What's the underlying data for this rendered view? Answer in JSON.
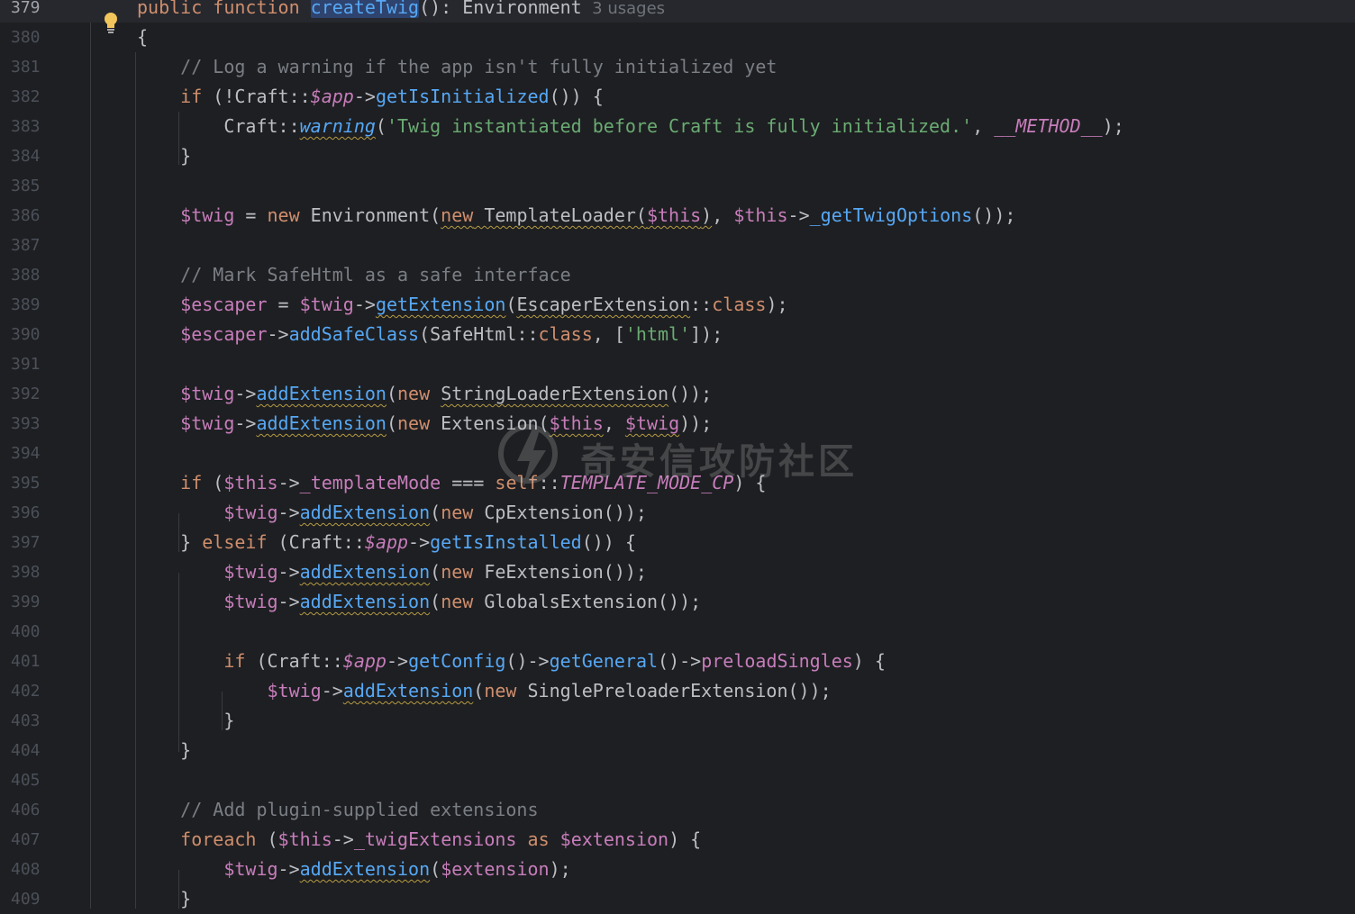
{
  "editor": {
    "current_line": 379,
    "usage_hint": "3 usages",
    "watermark": "奇安信攻防社区",
    "lines": [
      {
        "n": "379",
        "tokens": [
          [
            "kw",
            "public"
          ],
          [
            "pl",
            " "
          ],
          [
            "kw",
            "function"
          ],
          [
            "pl",
            " "
          ],
          [
            "fn hl",
            "createTwig"
          ],
          [
            "pl",
            "(): Environment"
          ]
        ]
      },
      {
        "n": "380",
        "tokens": [
          [
            "pl",
            "{"
          ]
        ]
      },
      {
        "n": "381",
        "tokens": [
          [
            "cmt",
            "    // Log a warning if the app isn't fully initialized yet"
          ]
        ]
      },
      {
        "n": "382",
        "tokens": [
          [
            "kw",
            "    if"
          ],
          [
            "pl",
            " (!Craft::"
          ],
          [
            "var it",
            "$app"
          ],
          [
            "pl",
            "->"
          ],
          [
            "fn",
            "getIsInitialized"
          ],
          [
            "pl",
            "()) {"
          ]
        ]
      },
      {
        "n": "383",
        "tokens": [
          [
            "pl",
            "        Craft::"
          ],
          [
            "fn it wv",
            "warning"
          ],
          [
            "pl",
            "("
          ],
          [
            "str",
            "'Twig instantiated before Craft is fully initialized.'"
          ],
          [
            "pl",
            ", "
          ],
          [
            "var it",
            "__METHOD__"
          ],
          [
            "pl",
            ");"
          ]
        ]
      },
      {
        "n": "384",
        "tokens": [
          [
            "pl",
            "    }"
          ]
        ]
      },
      {
        "n": "385",
        "tokens": []
      },
      {
        "n": "386",
        "tokens": [
          [
            "var",
            "    $twig"
          ],
          [
            "pl",
            " = "
          ],
          [
            "kw",
            "new"
          ],
          [
            "pl",
            " Environment("
          ],
          [
            "kw wv",
            "new"
          ],
          [
            "pl wv",
            " TemplateLoader("
          ],
          [
            "var wv",
            "$this"
          ],
          [
            "pl wv",
            ")"
          ],
          [
            "pl",
            ", "
          ],
          [
            "var",
            "$this"
          ],
          [
            "pl",
            "->"
          ],
          [
            "fn",
            "_getTwigOptions"
          ],
          [
            "pl",
            "());"
          ]
        ]
      },
      {
        "n": "387",
        "tokens": []
      },
      {
        "n": "388",
        "tokens": [
          [
            "cmt",
            "    // Mark SafeHtml as a safe interface"
          ]
        ]
      },
      {
        "n": "389",
        "tokens": [
          [
            "var",
            "    $escaper"
          ],
          [
            "pl",
            " = "
          ],
          [
            "var",
            "$twig"
          ],
          [
            "pl",
            "->"
          ],
          [
            "fn wv",
            "getExtension"
          ],
          [
            "pl",
            "("
          ],
          [
            "pl wv",
            "EscaperExtension"
          ],
          [
            "pl",
            "::"
          ],
          [
            "kw",
            "class"
          ],
          [
            "pl",
            ");"
          ]
        ]
      },
      {
        "n": "390",
        "tokens": [
          [
            "var",
            "    $escaper"
          ],
          [
            "pl",
            "->"
          ],
          [
            "fn",
            "addSafeClass"
          ],
          [
            "pl",
            "(SafeHtml::"
          ],
          [
            "kw",
            "class"
          ],
          [
            "pl",
            ", ["
          ],
          [
            "str",
            "'html'"
          ],
          [
            "pl",
            "]);"
          ]
        ]
      },
      {
        "n": "391",
        "tokens": []
      },
      {
        "n": "392",
        "tokens": [
          [
            "var",
            "    $twig"
          ],
          [
            "pl",
            "->"
          ],
          [
            "fn wv",
            "addExtension"
          ],
          [
            "pl",
            "("
          ],
          [
            "kw",
            "new"
          ],
          [
            "pl",
            " "
          ],
          [
            "pl wv",
            "StringLoaderExtension"
          ],
          [
            "pl",
            "());"
          ]
        ]
      },
      {
        "n": "393",
        "tokens": [
          [
            "var",
            "    $twig"
          ],
          [
            "pl",
            "->"
          ],
          [
            "fn wv",
            "addExtension"
          ],
          [
            "pl",
            "("
          ],
          [
            "kw",
            "new"
          ],
          [
            "pl",
            " Extension("
          ],
          [
            "var wv",
            "$this"
          ],
          [
            "pl",
            ", "
          ],
          [
            "var wv",
            "$twig"
          ],
          [
            "pl",
            "));"
          ]
        ]
      },
      {
        "n": "394",
        "tokens": []
      },
      {
        "n": "395",
        "tokens": [
          [
            "kw",
            "    if"
          ],
          [
            "pl",
            " ("
          ],
          [
            "var",
            "$this"
          ],
          [
            "pl",
            "->"
          ],
          [
            "var",
            "_templateMode"
          ],
          [
            "pl",
            " === "
          ],
          [
            "kw",
            "self"
          ],
          [
            "pl",
            "::"
          ],
          [
            "var it",
            "TEMPLATE_MODE_CP"
          ],
          [
            "pl",
            ") {"
          ]
        ]
      },
      {
        "n": "396",
        "tokens": [
          [
            "var",
            "        $twig"
          ],
          [
            "pl",
            "->"
          ],
          [
            "fn wv",
            "addExtension"
          ],
          [
            "pl",
            "("
          ],
          [
            "kw",
            "new"
          ],
          [
            "pl",
            " CpExtension());"
          ]
        ]
      },
      {
        "n": "397",
        "tokens": [
          [
            "pl",
            "    } "
          ],
          [
            "kw",
            "elseif"
          ],
          [
            "pl",
            " (Craft::"
          ],
          [
            "var it",
            "$app"
          ],
          [
            "pl",
            "->"
          ],
          [
            "fn",
            "getIsInstalled"
          ],
          [
            "pl",
            "()) {"
          ]
        ]
      },
      {
        "n": "398",
        "tokens": [
          [
            "var",
            "        $twig"
          ],
          [
            "pl",
            "->"
          ],
          [
            "fn wv",
            "addExtension"
          ],
          [
            "pl",
            "("
          ],
          [
            "kw",
            "new"
          ],
          [
            "pl",
            " FeExtension());"
          ]
        ]
      },
      {
        "n": "399",
        "tokens": [
          [
            "var",
            "        $twig"
          ],
          [
            "pl",
            "->"
          ],
          [
            "fn wv",
            "addExtension"
          ],
          [
            "pl",
            "("
          ],
          [
            "kw",
            "new"
          ],
          [
            "pl",
            " GlobalsExtension());"
          ]
        ]
      },
      {
        "n": "400",
        "tokens": []
      },
      {
        "n": "401",
        "tokens": [
          [
            "kw",
            "        if"
          ],
          [
            "pl",
            " (Craft::"
          ],
          [
            "var it",
            "$app"
          ],
          [
            "pl",
            "->"
          ],
          [
            "fn",
            "getConfig"
          ],
          [
            "pl",
            "()->"
          ],
          [
            "fn",
            "getGeneral"
          ],
          [
            "pl",
            "()->"
          ],
          [
            "var",
            "preloadSingles"
          ],
          [
            "pl",
            ") {"
          ]
        ]
      },
      {
        "n": "402",
        "tokens": [
          [
            "var",
            "            $twig"
          ],
          [
            "pl",
            "->"
          ],
          [
            "fn wv",
            "addExtension"
          ],
          [
            "pl",
            "("
          ],
          [
            "kw",
            "new"
          ],
          [
            "pl",
            " SinglePreloaderExtension());"
          ]
        ]
      },
      {
        "n": "403",
        "tokens": [
          [
            "pl",
            "        }"
          ]
        ]
      },
      {
        "n": "404",
        "tokens": [
          [
            "pl",
            "    }"
          ]
        ]
      },
      {
        "n": "405",
        "tokens": []
      },
      {
        "n": "406",
        "tokens": [
          [
            "cmt",
            "    // Add plugin-supplied extensions"
          ]
        ]
      },
      {
        "n": "407",
        "tokens": [
          [
            "kw",
            "    foreach"
          ],
          [
            "pl",
            " ("
          ],
          [
            "var",
            "$this"
          ],
          [
            "pl",
            "->"
          ],
          [
            "var",
            "_twigExtensions"
          ],
          [
            "pl",
            " "
          ],
          [
            "kw",
            "as"
          ],
          [
            "pl",
            " "
          ],
          [
            "var",
            "$extension"
          ],
          [
            "pl",
            ") {"
          ]
        ]
      },
      {
        "n": "408",
        "tokens": [
          [
            "var",
            "        $twig"
          ],
          [
            "pl",
            "->"
          ],
          [
            "fn wv",
            "addExtension"
          ],
          [
            "pl",
            "("
          ],
          [
            "var",
            "$extension"
          ],
          [
            "pl",
            ");"
          ]
        ]
      },
      {
        "n": "409",
        "tokens": [
          [
            "pl",
            "    }"
          ]
        ]
      }
    ]
  },
  "colors": {
    "background": "#1e1f22",
    "keyword": "#cf8e6d",
    "variable": "#c77dbb",
    "function": "#56a8f5",
    "string": "#6aab73",
    "comment": "#7a7e85"
  }
}
